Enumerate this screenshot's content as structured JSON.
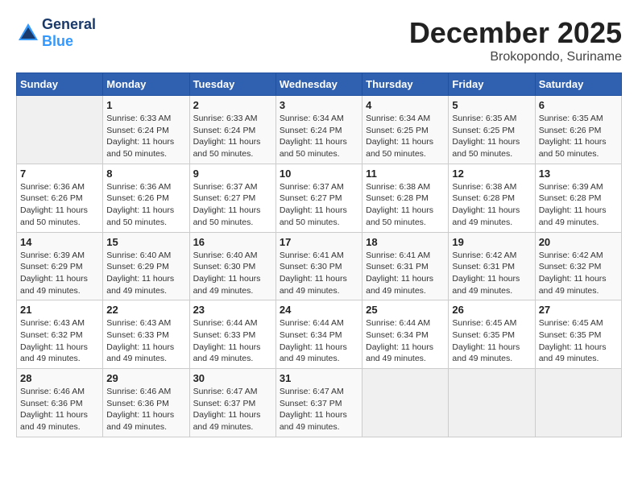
{
  "header": {
    "logo_general": "General",
    "logo_blue": "Blue",
    "month": "December 2025",
    "location": "Brokopondo, Suriname"
  },
  "days_of_week": [
    "Sunday",
    "Monday",
    "Tuesday",
    "Wednesday",
    "Thursday",
    "Friday",
    "Saturday"
  ],
  "weeks": [
    [
      {
        "day": "",
        "info": ""
      },
      {
        "day": "1",
        "info": "Sunrise: 6:33 AM\nSunset: 6:24 PM\nDaylight: 11 hours\nand 50 minutes."
      },
      {
        "day": "2",
        "info": "Sunrise: 6:33 AM\nSunset: 6:24 PM\nDaylight: 11 hours\nand 50 minutes."
      },
      {
        "day": "3",
        "info": "Sunrise: 6:34 AM\nSunset: 6:24 PM\nDaylight: 11 hours\nand 50 minutes."
      },
      {
        "day": "4",
        "info": "Sunrise: 6:34 AM\nSunset: 6:25 PM\nDaylight: 11 hours\nand 50 minutes."
      },
      {
        "day": "5",
        "info": "Sunrise: 6:35 AM\nSunset: 6:25 PM\nDaylight: 11 hours\nand 50 minutes."
      },
      {
        "day": "6",
        "info": "Sunrise: 6:35 AM\nSunset: 6:26 PM\nDaylight: 11 hours\nand 50 minutes."
      }
    ],
    [
      {
        "day": "7",
        "info": "Sunrise: 6:36 AM\nSunset: 6:26 PM\nDaylight: 11 hours\nand 50 minutes."
      },
      {
        "day": "8",
        "info": "Sunrise: 6:36 AM\nSunset: 6:26 PM\nDaylight: 11 hours\nand 50 minutes."
      },
      {
        "day": "9",
        "info": "Sunrise: 6:37 AM\nSunset: 6:27 PM\nDaylight: 11 hours\nand 50 minutes."
      },
      {
        "day": "10",
        "info": "Sunrise: 6:37 AM\nSunset: 6:27 PM\nDaylight: 11 hours\nand 50 minutes."
      },
      {
        "day": "11",
        "info": "Sunrise: 6:38 AM\nSunset: 6:28 PM\nDaylight: 11 hours\nand 50 minutes."
      },
      {
        "day": "12",
        "info": "Sunrise: 6:38 AM\nSunset: 6:28 PM\nDaylight: 11 hours\nand 49 minutes."
      },
      {
        "day": "13",
        "info": "Sunrise: 6:39 AM\nSunset: 6:28 PM\nDaylight: 11 hours\nand 49 minutes."
      }
    ],
    [
      {
        "day": "14",
        "info": "Sunrise: 6:39 AM\nSunset: 6:29 PM\nDaylight: 11 hours\nand 49 minutes."
      },
      {
        "day": "15",
        "info": "Sunrise: 6:40 AM\nSunset: 6:29 PM\nDaylight: 11 hours\nand 49 minutes."
      },
      {
        "day": "16",
        "info": "Sunrise: 6:40 AM\nSunset: 6:30 PM\nDaylight: 11 hours\nand 49 minutes."
      },
      {
        "day": "17",
        "info": "Sunrise: 6:41 AM\nSunset: 6:30 PM\nDaylight: 11 hours\nand 49 minutes."
      },
      {
        "day": "18",
        "info": "Sunrise: 6:41 AM\nSunset: 6:31 PM\nDaylight: 11 hours\nand 49 minutes."
      },
      {
        "day": "19",
        "info": "Sunrise: 6:42 AM\nSunset: 6:31 PM\nDaylight: 11 hours\nand 49 minutes."
      },
      {
        "day": "20",
        "info": "Sunrise: 6:42 AM\nSunset: 6:32 PM\nDaylight: 11 hours\nand 49 minutes."
      }
    ],
    [
      {
        "day": "21",
        "info": "Sunrise: 6:43 AM\nSunset: 6:32 PM\nDaylight: 11 hours\nand 49 minutes."
      },
      {
        "day": "22",
        "info": "Sunrise: 6:43 AM\nSunset: 6:33 PM\nDaylight: 11 hours\nand 49 minutes."
      },
      {
        "day": "23",
        "info": "Sunrise: 6:44 AM\nSunset: 6:33 PM\nDaylight: 11 hours\nand 49 minutes."
      },
      {
        "day": "24",
        "info": "Sunrise: 6:44 AM\nSunset: 6:34 PM\nDaylight: 11 hours\nand 49 minutes."
      },
      {
        "day": "25",
        "info": "Sunrise: 6:44 AM\nSunset: 6:34 PM\nDaylight: 11 hours\nand 49 minutes."
      },
      {
        "day": "26",
        "info": "Sunrise: 6:45 AM\nSunset: 6:35 PM\nDaylight: 11 hours\nand 49 minutes."
      },
      {
        "day": "27",
        "info": "Sunrise: 6:45 AM\nSunset: 6:35 PM\nDaylight: 11 hours\nand 49 minutes."
      }
    ],
    [
      {
        "day": "28",
        "info": "Sunrise: 6:46 AM\nSunset: 6:36 PM\nDaylight: 11 hours\nand 49 minutes."
      },
      {
        "day": "29",
        "info": "Sunrise: 6:46 AM\nSunset: 6:36 PM\nDaylight: 11 hours\nand 49 minutes."
      },
      {
        "day": "30",
        "info": "Sunrise: 6:47 AM\nSunset: 6:37 PM\nDaylight: 11 hours\nand 49 minutes."
      },
      {
        "day": "31",
        "info": "Sunrise: 6:47 AM\nSunset: 6:37 PM\nDaylight: 11 hours\nand 49 minutes."
      },
      {
        "day": "",
        "info": ""
      },
      {
        "day": "",
        "info": ""
      },
      {
        "day": "",
        "info": ""
      }
    ]
  ]
}
